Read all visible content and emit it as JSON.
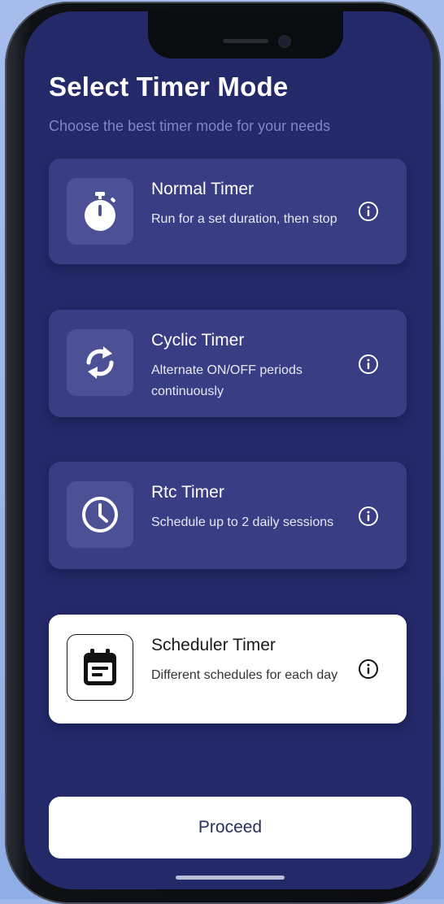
{
  "header": {
    "title": "Select Timer Mode",
    "subtitle": "Choose the best timer mode for your needs"
  },
  "modes": [
    {
      "title": "Normal Timer",
      "description": "Run for a set duration, then stop",
      "icon": "stopwatch-icon",
      "selected": false
    },
    {
      "title": "Cyclic Timer",
      "description": "Alternate ON/OFF periods continuously",
      "icon": "cycle-arrows-icon",
      "selected": false
    },
    {
      "title": "Rtc Timer",
      "description": "Schedule up to 2 daily sessions",
      "icon": "clock-icon",
      "selected": false
    },
    {
      "title": "Scheduler Timer",
      "description": "Different schedules for each day",
      "icon": "calendar-icon",
      "selected": true
    }
  ],
  "footer": {
    "proceed_label": "Proceed"
  },
  "colors": {
    "screen_bg": "#24296a",
    "card_bg": "#383d84",
    "icon_box_bg": "#4c5196",
    "selected_card_bg": "#ffffff",
    "subtitle": "#7c86c8"
  }
}
